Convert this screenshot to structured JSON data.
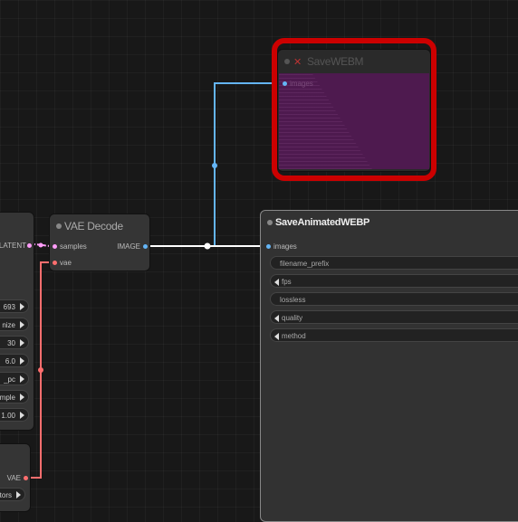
{
  "colors": {
    "image_wire": "#64b5f6",
    "latent_wire": "#ff9cf9",
    "vae_wire": "#ff6e6e",
    "highlight": "#cc0000",
    "preview_fill": "#4e1a4f"
  },
  "save_webm": {
    "title": "SaveWEBM",
    "input_label": "images",
    "close_icon": "✕"
  },
  "vae_decode": {
    "title": "VAE Decode",
    "inputs": [
      "samples",
      "vae"
    ],
    "output": "IMAGE"
  },
  "save_anim": {
    "title": "SaveAnimatedWEBP",
    "input": "images",
    "widgets": [
      {
        "label": "filename_prefix"
      },
      {
        "label": "fps"
      },
      {
        "label": "lossless"
      },
      {
        "label": "quality"
      },
      {
        "label": "method"
      }
    ]
  },
  "left_node": {
    "output": "LATENT",
    "widgets": [
      {
        "value": "693"
      },
      {
        "value": "nize"
      },
      {
        "value": "30"
      },
      {
        "value": "6.0"
      },
      {
        "value": "_pc"
      },
      {
        "value": "mple"
      },
      {
        "value": "1.00"
      }
    ]
  },
  "left_node2": {
    "output": "VAE",
    "widget": "tors"
  }
}
